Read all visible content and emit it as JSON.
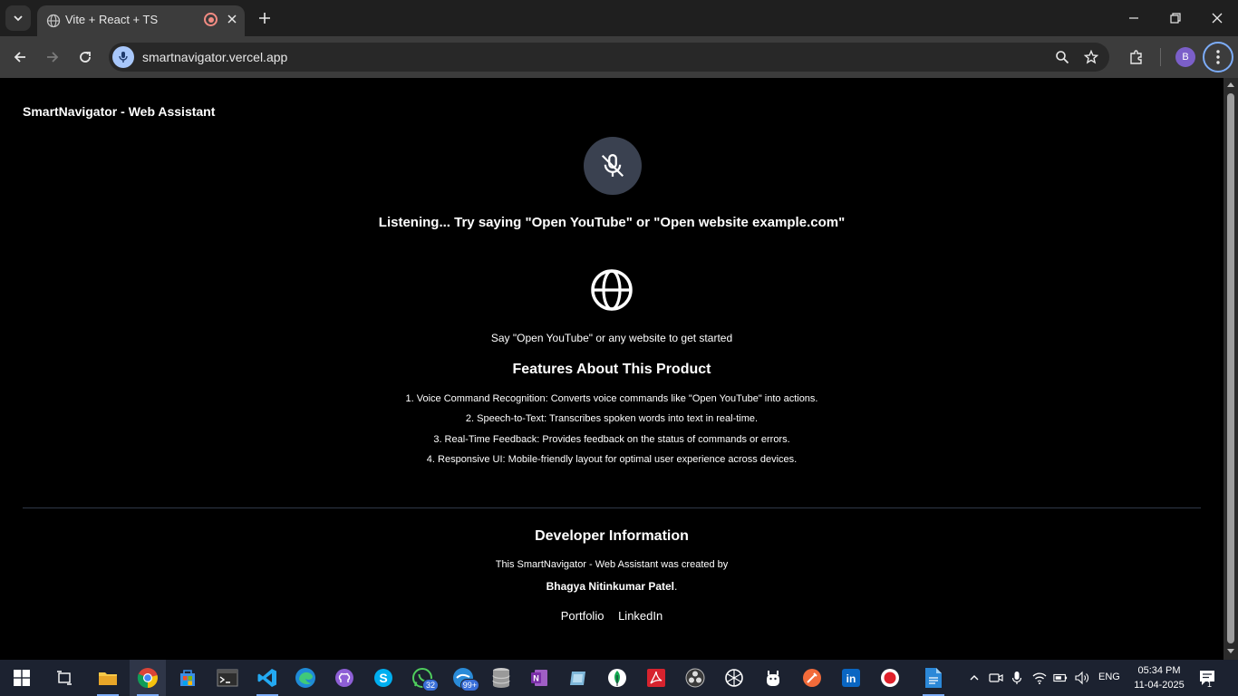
{
  "browser": {
    "tab_title": "Vite + React + TS",
    "url": "smartnavigator.vercel.app",
    "profile_initial": "B"
  },
  "page": {
    "brand": "SmartNavigator - Web Assistant",
    "listening_text": "Listening... Try saying \"Open YouTube\" or \"Open website example.com\"",
    "say_text": "Say \"Open YouTube\" or any website to get started",
    "features_title": "Features About This Product",
    "features": [
      "1. Voice Command Recognition: Converts voice commands like \"Open YouTube\" into actions.",
      "2. Speech-to-Text: Transcribes spoken words into text in real-time.",
      "3. Real-Time Feedback: Provides feedback on the status of commands or errors.",
      "4. Responsive UI: Mobile-friendly layout for optimal user experience across devices."
    ],
    "developer": {
      "title": "Developer Information",
      "text": "This SmartNavigator - Web Assistant was created by",
      "name": "Bhagya Nitinkumar Patel",
      "name_suffix": ".",
      "links": [
        "Portfolio",
        "LinkedIn"
      ]
    }
  },
  "taskbar": {
    "whatsapp_badge": "32",
    "mail_badge": "99+",
    "language": "ENG",
    "time": "05:34 PM",
    "date": "11-04-2025",
    "notification_count": "1"
  },
  "colors": {
    "chrome_bg": "#1f1f1f",
    "toolbar_bg": "#3c3c3c",
    "page_bg": "#000000",
    "mic_circle": "#3a4150",
    "taskbar_bg": "#1c2230",
    "accent": "#7cacf8"
  }
}
